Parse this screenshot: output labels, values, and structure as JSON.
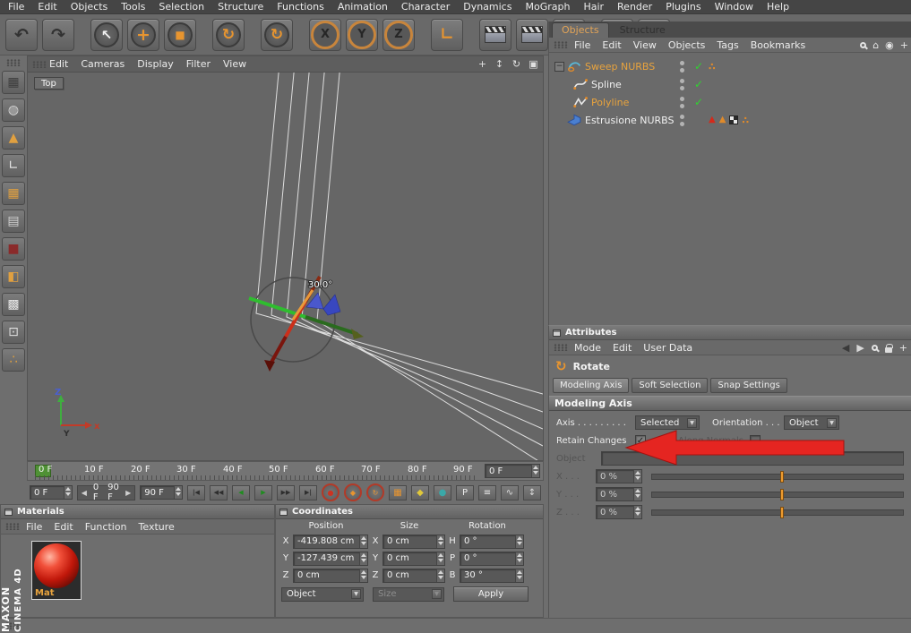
{
  "menubar": {
    "items": [
      "File",
      "Edit",
      "Objects",
      "Tools",
      "Selection",
      "Structure",
      "Functions",
      "Animation",
      "Character",
      "Dynamics",
      "MoGraph",
      "Hair",
      "Render",
      "Plugins",
      "Window",
      "Help"
    ]
  },
  "toolbar": {
    "axis_locks": [
      "X",
      "Y",
      "Z"
    ]
  },
  "icons": {
    "undo": "↶",
    "redo": "↷",
    "select": "↖",
    "move": "+",
    "scale": "■",
    "rotate": "↻",
    "axis_corner": "∟",
    "wave": "∿",
    "pan": "+",
    "dolly": "↕",
    "orbit": "↻",
    "maximize": "▣",
    "home": "⌂",
    "add": "+",
    "back": "◀",
    "forward": "▶",
    "lines": "≡",
    "pstart": "|◀",
    "prevkey": "◀◀",
    "prevframe": "◀",
    "nextframe": "▶",
    "nextkey": "▶▶",
    "pend": "▶|",
    "circle": "●",
    "diamond": "◆",
    "square": "■",
    "grid": "▦",
    "rows": "▤",
    "sphere": "◍",
    "boxsel": "◧",
    "boxgrid": "▩",
    "boxarrow": "⊡",
    "dots": "∴",
    "tri": "▲",
    "check": "✓",
    "collapse": "−",
    "pkey": "P",
    "eye": "◉",
    "updown": "↕",
    "arrow_up": "▲"
  },
  "viewport": {
    "menu": [
      "Edit",
      "Cameras",
      "Display",
      "Filter",
      "View"
    ],
    "view_label": "Top",
    "angle_label": "30.0°"
  },
  "objects_panel": {
    "tabs": [
      "Objects",
      "Structure"
    ],
    "menu": [
      "File",
      "Edit",
      "View",
      "Objects",
      "Tags",
      "Bookmarks"
    ],
    "tree": [
      {
        "label": "Sweep NURBS"
      },
      {
        "label": "Spline"
      },
      {
        "label": "Polyline"
      },
      {
        "label": "Estrusione NURBS"
      }
    ]
  },
  "attributes_panel": {
    "title": "Attributes",
    "menu": [
      "Mode",
      "Edit",
      "User Data"
    ],
    "tool": "Rotate",
    "tabs": [
      "Modeling Axis",
      "Soft Selection",
      "Snap Settings"
    ],
    "section_title": "Modeling Axis",
    "rows": {
      "axis_label": "Axis . . . . . . . . .",
      "axis_value": "Selected",
      "orientation_label": "Orientation . . .",
      "orientation_value": "Object",
      "retain_label": "Retain Changes",
      "along_label": "Along Normals",
      "object_label": "Object",
      "object_value": "",
      "x_label": "X . . .",
      "x_value": "0 %",
      "y_label": "Y . . .",
      "y_value": "0 %",
      "z_label": "Z . . .",
      "z_value": "0 %"
    }
  },
  "timeline": {
    "ticks": [
      "0 F",
      "10 F",
      "20 F",
      "30 F",
      "40 F",
      "50 F",
      "60 F",
      "70 F",
      "80 F",
      "90 F"
    ],
    "current_frame": "0 F",
    "start_field": "0 F",
    "range_min": "0 F",
    "range_max": "90 F",
    "end_field": "90 F"
  },
  "materials_panel": {
    "title": "Materials",
    "menu": [
      "File",
      "Edit",
      "Function",
      "Texture"
    ],
    "material_name": "Mat"
  },
  "coordinates_panel": {
    "title": "Coordinates",
    "columns": [
      "Position",
      "Size",
      "Rotation"
    ],
    "rows": [
      {
        "pl": "X",
        "pv": "-419.808 cm",
        "sl": "X",
        "sv": "0 cm",
        "rl": "H",
        "rv": "0 °"
      },
      {
        "pl": "Y",
        "pv": "-127.439 cm",
        "sl": "Y",
        "sv": "0 cm",
        "rl": "P",
        "rv": "0 °"
      },
      {
        "pl": "Z",
        "pv": "0 cm",
        "sl": "Z",
        "sv": "0 cm",
        "rl": "B",
        "rv": "30 °"
      }
    ],
    "object_dropdown": "Object",
    "size_dropdown": "Size",
    "apply_label": "Apply"
  },
  "branding": {
    "line1": "MAXON",
    "line2": "CINEMA 4D"
  }
}
